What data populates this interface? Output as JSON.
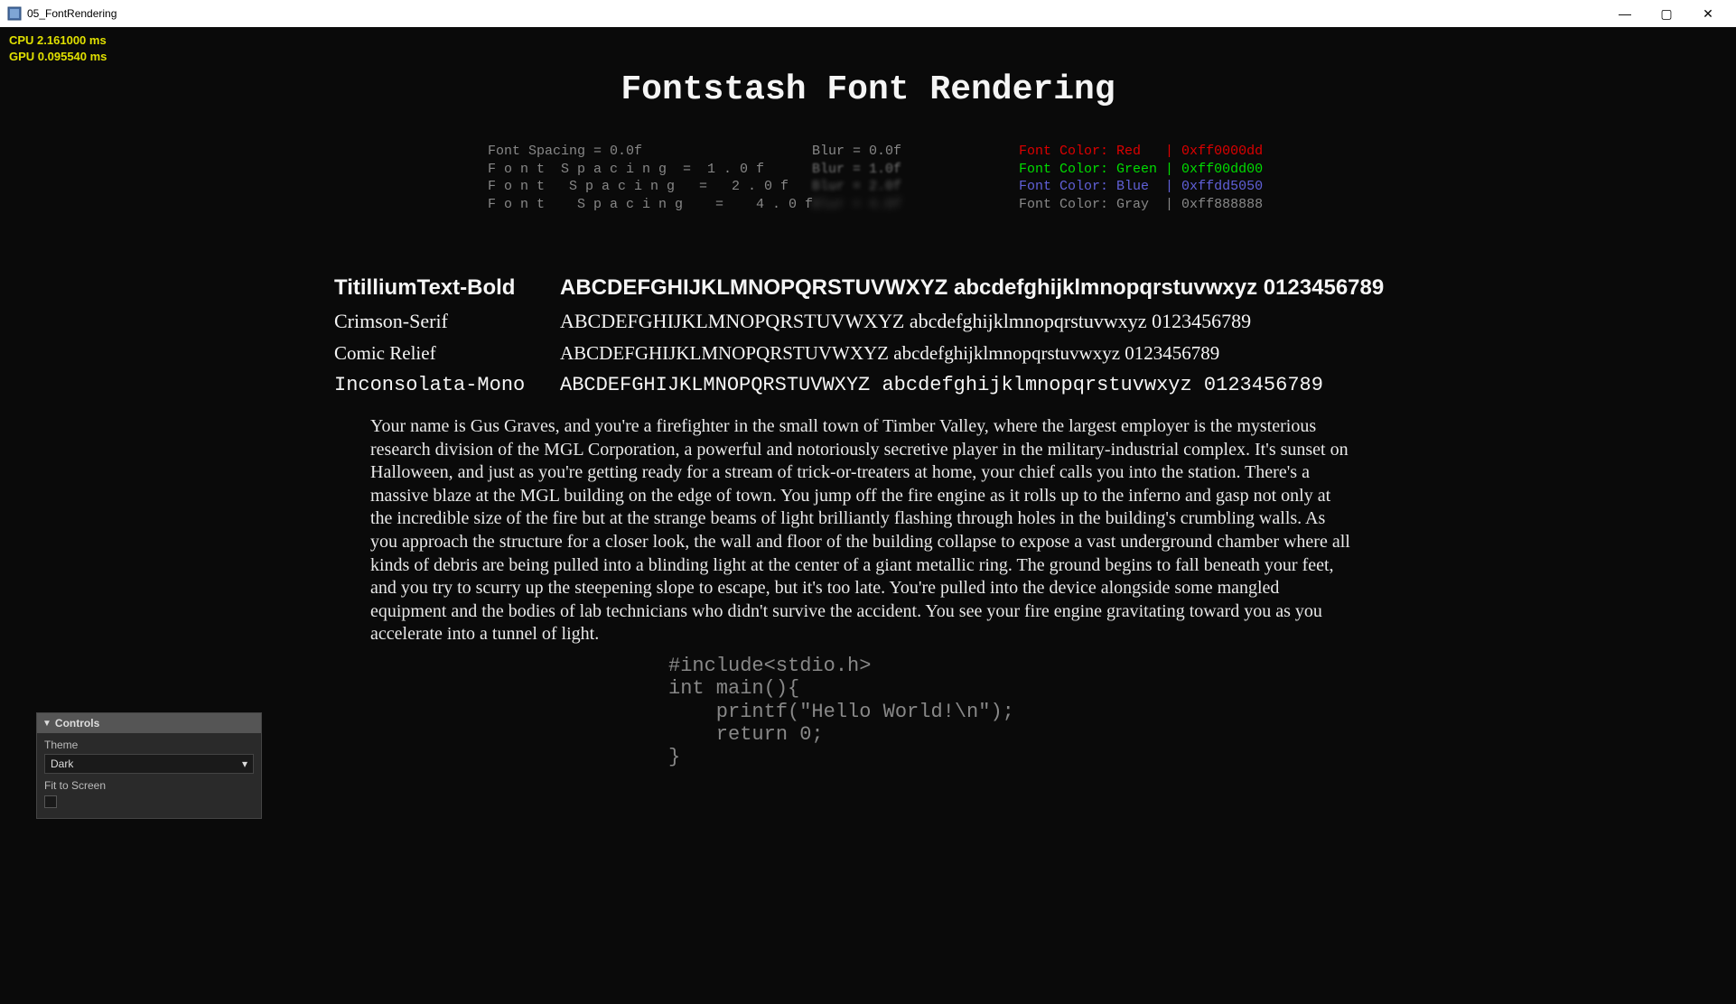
{
  "window": {
    "title": "05_FontRendering"
  },
  "perf": {
    "cpu": "CPU 2.161000 ms",
    "gpu": "GPU 0.095540 ms"
  },
  "title": "Fontstash Font Rendering",
  "spacing": {
    "r0": "Font Spacing = 0.0f",
    "r1": "F o n t  S p a c i n g  =  1 . 0 f",
    "r2": "F o n t   S p a c i n g   =   2 . 0 f",
    "r3": "F o n t    S p a c i n g    =    4 . 0 f"
  },
  "blur": {
    "b1": "Blur = 0.0f",
    "b2": "Blur = 1.0f",
    "b3": "Blur = 2.0f",
    "b4": "Blur = 4.0f"
  },
  "colors": {
    "red": "Font Color: Red   | 0xff0000dd",
    "green": "Font Color: Green | 0xff00dd00",
    "blue": "Font Color: Blue  | 0xffdd5050",
    "gray": "Font Color: Gray  | 0xff888888"
  },
  "fonts": {
    "row0": {
      "name": "TitilliumText-Bold",
      "sample": "ABCDEFGHIJKLMNOPQRSTUVWXYZ abcdefghijklmnopqrstuvwxyz 0123456789"
    },
    "row1": {
      "name": "Crimson-Serif",
      "sample": "ABCDEFGHIJKLMNOPQRSTUVWXYZ abcdefghijklmnopqrstuvwxyz 0123456789"
    },
    "row2": {
      "name": "Comic Relief",
      "sample": "ABCDEFGHIJKLMNOPQRSTUVWXYZ abcdefghijklmnopqrstuvwxyz 0123456789"
    },
    "row3": {
      "name": "Inconsolata-Mono",
      "sample": "ABCDEFGHIJKLMNOPQRSTUVWXYZ abcdefghijklmnopqrstuvwxyz 0123456789"
    }
  },
  "story": "Your name is Gus Graves, and you're a firefighter in the small town of Timber Valley, where the largest employer is the mysterious research division of the MGL Corporation, a powerful and notoriously secretive player in the military-industrial complex. It's sunset on Halloween, and just as you're getting ready for a stream of trick-or-treaters at home, your chief calls you into the station. There's a massive blaze at the MGL building on the edge of town. You jump off the fire engine as it rolls up to the inferno and gasp not only at the incredible size of the fire but at the strange beams of light brilliantly flashing through holes in the building's crumbling walls. As you approach the structure for a closer look, the wall and floor of the building collapse to expose a vast underground chamber where all kinds of debris are being pulled into a blinding light at the center of a giant metallic ring. The ground begins to fall beneath your feet, and you try to scurry up the steepening slope to escape, but it's too late. You're pulled into the device alongside some mangled equipment and the bodies of lab technicians who didn't survive the accident. You see your fire engine gravitating toward you as you accelerate into a tunnel of light.",
  "code": "#include<stdio.h>\nint main(){\n    printf(\"Hello World!\\n\");\n    return 0;\n}",
  "controls": {
    "header": "Controls",
    "theme_label": "Theme",
    "theme_value": "Dark",
    "fit_label": "Fit to Screen"
  }
}
